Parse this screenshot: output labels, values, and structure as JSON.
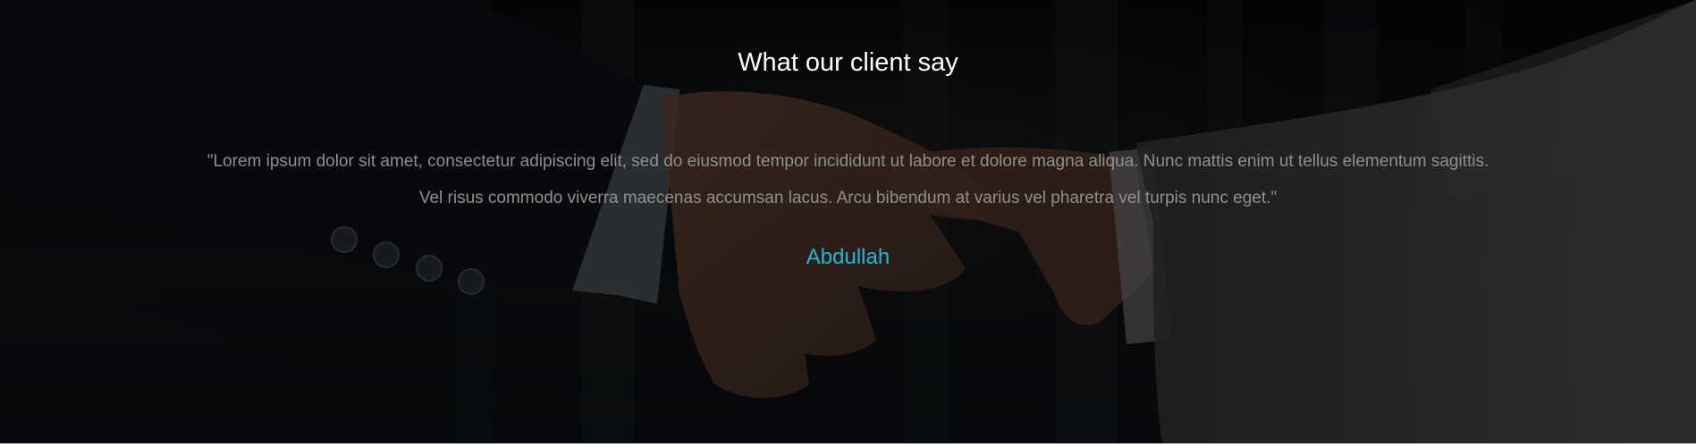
{
  "testimonial": {
    "title": "What our client say",
    "quote": "\"Lorem ipsum dolor sit amet, consectetur adipiscing elit, sed do eiusmod tempor incididunt ut labore et dolore magna aliqua. Nunc mattis enim ut tellus elementum sagittis. Vel risus commodo viverra maecenas accumsan lacus. Arcu bibendum at varius vel pharetra vel turpis nunc eget.\"",
    "author": "Abdullah"
  },
  "colors": {
    "title": "#ffffff",
    "quote": "#8f8f8f",
    "author_accent": "#1fb8d8",
    "overlay": "#0b0d10"
  },
  "background": {
    "subject": "handshake-photo"
  }
}
